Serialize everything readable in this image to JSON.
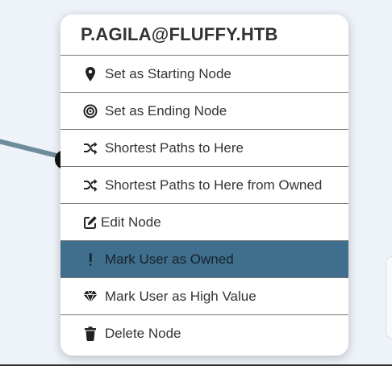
{
  "menu": {
    "title": "P.AGILA@FLUFFY.HTB",
    "items": [
      {
        "label": "Set as Starting Node",
        "icon": "map-marker-icon"
      },
      {
        "label": "Set as Ending Node",
        "icon": "target-icon"
      },
      {
        "label": "Shortest Paths to Here",
        "icon": "shuffle-icon"
      },
      {
        "label": "Shortest Paths to Here from Owned",
        "icon": "shuffle-icon"
      },
      {
        "label": "Edit Node",
        "icon": "edit-icon"
      },
      {
        "label": "Mark User as Owned",
        "icon": "exclamation-icon"
      },
      {
        "label": "Mark User as High Value",
        "icon": "gem-icon"
      },
      {
        "label": "Delete Node",
        "icon": "trash-icon"
      }
    ]
  },
  "colors": {
    "highlight": "#3f6f8d",
    "menu_bg": "#ffffff",
    "canvas_bg": "#eef3f9"
  }
}
